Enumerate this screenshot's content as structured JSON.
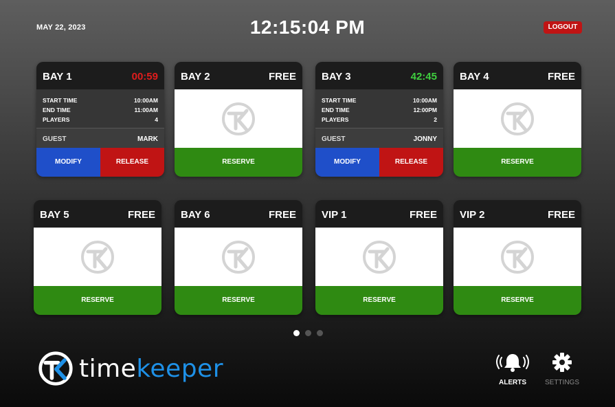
{
  "header": {
    "date": "MAY 22, 2023",
    "time": "12:15:04 PM",
    "logout_label": "LOGOUT"
  },
  "bays": [
    {
      "name": "BAY 1",
      "status": "00:59",
      "status_color": "#e01c1c",
      "state": "occupied",
      "start_label": "START TIME",
      "start_value": "10:00AM",
      "end_label": "END TIME",
      "end_value": "11:00AM",
      "players_label": "PLAYERS",
      "players_value": "4",
      "guest_label": "GUEST",
      "guest_value": "MARK",
      "modify_label": "MODIFY",
      "release_label": "RELEASE"
    },
    {
      "name": "BAY 2",
      "status": "FREE",
      "state": "free",
      "reserve_label": "RESERVE"
    },
    {
      "name": "BAY 3",
      "status": "42:45",
      "status_color": "#3fcf3f",
      "state": "occupied",
      "start_label": "START TIME",
      "start_value": "10:00AM",
      "end_label": "END TIME",
      "end_value": "12:00PM",
      "players_label": "PLAYERS",
      "players_value": "2",
      "guest_label": "GUEST",
      "guest_value": "JONNY",
      "modify_label": "MODIFY",
      "release_label": "RELEASE"
    },
    {
      "name": "BAY 4",
      "status": "FREE",
      "state": "free",
      "reserve_label": "RESERVE"
    },
    {
      "name": "BAY 5",
      "status": "FREE",
      "state": "free",
      "reserve_label": "RESERVE"
    },
    {
      "name": "BAY 6",
      "status": "FREE",
      "state": "free",
      "reserve_label": "RESERVE"
    },
    {
      "name": "VIP 1",
      "status": "FREE",
      "state": "free",
      "reserve_label": "RESERVE"
    },
    {
      "name": "VIP 2",
      "status": "FREE",
      "state": "free",
      "reserve_label": "RESERVE"
    }
  ],
  "pagination": {
    "pages": 3,
    "current": 1
  },
  "brand": {
    "part1": "time",
    "part2": "keeper",
    "accent": "#1e90e6",
    "icon": "timekeeper-logo-icon"
  },
  "nav": {
    "alerts_label": "ALERTS",
    "alerts_icon": "bell-alert-icon",
    "settings_label": "SETTINGS",
    "settings_icon": "gear-icon"
  },
  "colors": {
    "reserve": "#2f8a12",
    "modify": "#1f4fc9",
    "release": "#c01414",
    "logout": "#c01414"
  }
}
